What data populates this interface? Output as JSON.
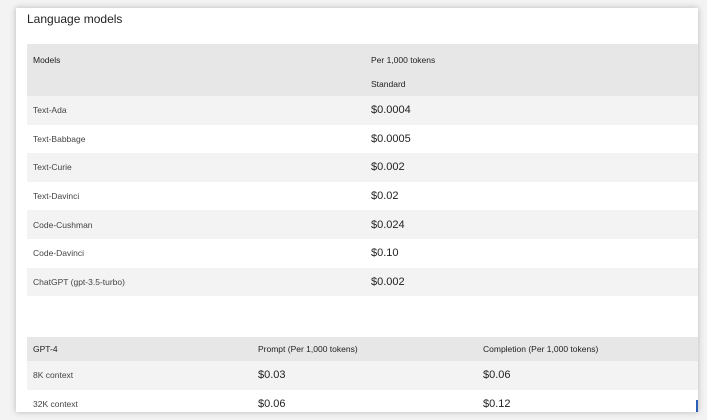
{
  "section": {
    "title": "Language models"
  },
  "table1": {
    "headers": {
      "models": "Models",
      "per_tokens": "Per 1,000 tokens",
      "standard": "Standard"
    },
    "rows": [
      {
        "model": "Text-Ada",
        "price": "$0.0004"
      },
      {
        "model": "Text-Babbage",
        "price": "$0.0005"
      },
      {
        "model": "Text-Curie",
        "price": "$0.002"
      },
      {
        "model": "Text-Davinci",
        "price": "$0.02"
      },
      {
        "model": "Code-Cushman",
        "price": "$0.024"
      },
      {
        "model": "Code-Davinci",
        "price": "$0.10"
      },
      {
        "model": "ChatGPT (gpt-3.5-turbo)",
        "price": "$0.002"
      }
    ]
  },
  "table2": {
    "headers": {
      "model": "GPT-4",
      "prompt": "Prompt (Per 1,000 tokens)",
      "completion": "Completion (Per 1,000 tokens)"
    },
    "rows": [
      {
        "context": "8K context",
        "prompt": "$0.03",
        "completion": "$0.06"
      },
      {
        "context": "32K context",
        "prompt": "$0.06",
        "completion": "$0.12"
      }
    ]
  }
}
